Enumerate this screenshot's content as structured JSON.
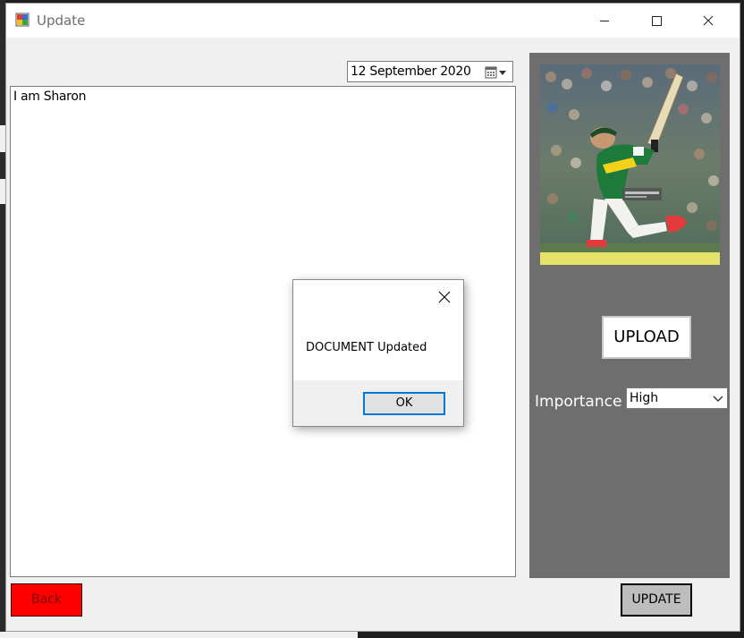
{
  "window": {
    "title": "Update",
    "controls": {
      "minimize": "minimize-icon",
      "maximize": "maximize-icon",
      "close": "close-icon"
    }
  },
  "form": {
    "date_value": "12 September 2020",
    "description_text": "I am Sharon",
    "upload_label": "UPLOAD",
    "importance_label": "Importance",
    "importance_value": "High",
    "back_label": "Back",
    "update_label": "UPDATE"
  },
  "dialog": {
    "message": "DOCUMENT Updated",
    "ok_label": "OK"
  },
  "colors": {
    "back_button": "#ff0000",
    "right_panel": "#6e6e6e",
    "focus_border": "#0078d7"
  }
}
